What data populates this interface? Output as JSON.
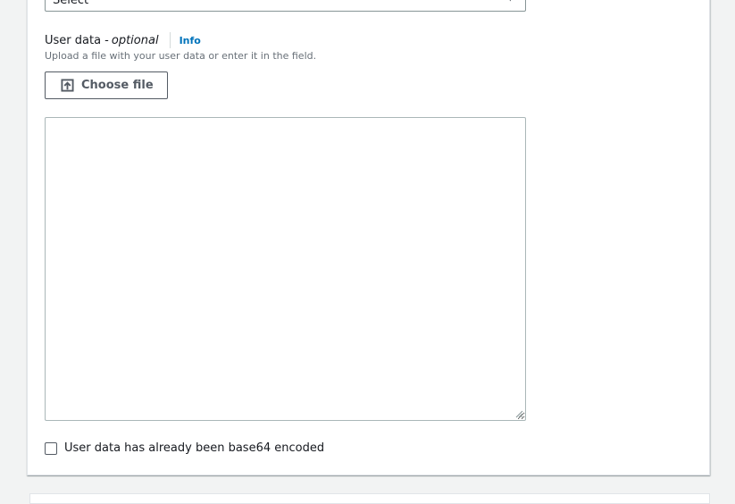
{
  "ami_select": {
    "value": "Select"
  },
  "user_data": {
    "label": "User data -",
    "optional": "optional",
    "info": "Info",
    "description": "Upload a file with your user data or enter it in the field.",
    "choose_file": "Choose file",
    "textarea_value": ""
  },
  "base64_checkbox": {
    "label": "User data has already been base64 encoded",
    "checked": false
  }
}
